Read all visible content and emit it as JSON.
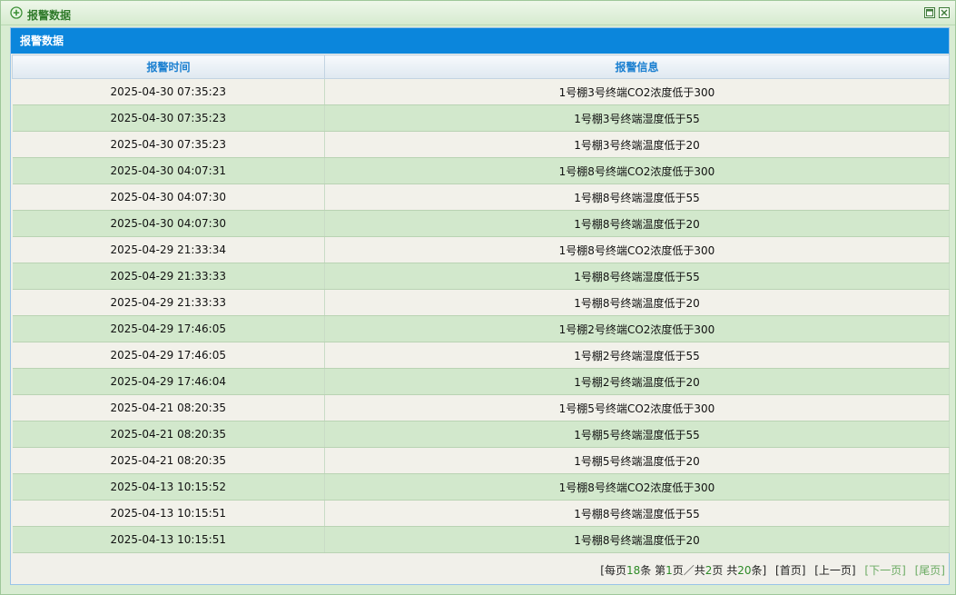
{
  "window": {
    "title": "报警数据"
  },
  "panel": {
    "title": "报警数据"
  },
  "table": {
    "columns": [
      "报警时间",
      "报警信息"
    ],
    "rows": [
      {
        "time": "2025-04-30 07:35:23",
        "info": "1号棚3号终端CO2浓度低于300"
      },
      {
        "time": "2025-04-30 07:35:23",
        "info": "1号棚3号终端湿度低于55"
      },
      {
        "time": "2025-04-30 07:35:23",
        "info": "1号棚3号终端温度低于20"
      },
      {
        "time": "2025-04-30 04:07:31",
        "info": "1号棚8号终端CO2浓度低于300"
      },
      {
        "time": "2025-04-30 04:07:30",
        "info": "1号棚8号终端湿度低于55"
      },
      {
        "time": "2025-04-30 04:07:30",
        "info": "1号棚8号终端温度低于20"
      },
      {
        "time": "2025-04-29 21:33:34",
        "info": "1号棚8号终端CO2浓度低于300"
      },
      {
        "time": "2025-04-29 21:33:33",
        "info": "1号棚8号终端湿度低于55"
      },
      {
        "time": "2025-04-29 21:33:33",
        "info": "1号棚8号终端温度低于20"
      },
      {
        "time": "2025-04-29 17:46:05",
        "info": "1号棚2号终端CO2浓度低于300"
      },
      {
        "time": "2025-04-29 17:46:05",
        "info": "1号棚2号终端湿度低于55"
      },
      {
        "time": "2025-04-29 17:46:04",
        "info": "1号棚2号终端温度低于20"
      },
      {
        "time": "2025-04-21 08:20:35",
        "info": "1号棚5号终端CO2浓度低于300"
      },
      {
        "time": "2025-04-21 08:20:35",
        "info": "1号棚5号终端湿度低于55"
      },
      {
        "time": "2025-04-21 08:20:35",
        "info": "1号棚5号终端温度低于20"
      },
      {
        "time": "2025-04-13 10:15:52",
        "info": "1号棚8号终端CO2浓度低于300"
      },
      {
        "time": "2025-04-13 10:15:51",
        "info": "1号棚8号终端湿度低于55"
      },
      {
        "time": "2025-04-13 10:15:51",
        "info": "1号棚8号终端温度低于20"
      }
    ]
  },
  "pager": {
    "per_page_prefix": "[每页",
    "per_page": "18",
    "per_page_suffix": "条 第",
    "current_page": "1",
    "page_mid": "页／共",
    "total_pages": "2",
    "pages_suffix": "页 共",
    "total_records": "20",
    "records_suffix": "条]",
    "first": "[首页]",
    "prev": "[上一页]",
    "next": "[下一页]",
    "last": "[尾页]"
  },
  "icons": {
    "title_icon": "add-circle-icon",
    "maximize": "maximize-icon",
    "close": "close-icon"
  },
  "colors": {
    "header_blue": "#0b86dc",
    "row_green": "#d2e8cc",
    "row_light": "#f2f1ea",
    "column_header_text": "#1a7fd0"
  }
}
